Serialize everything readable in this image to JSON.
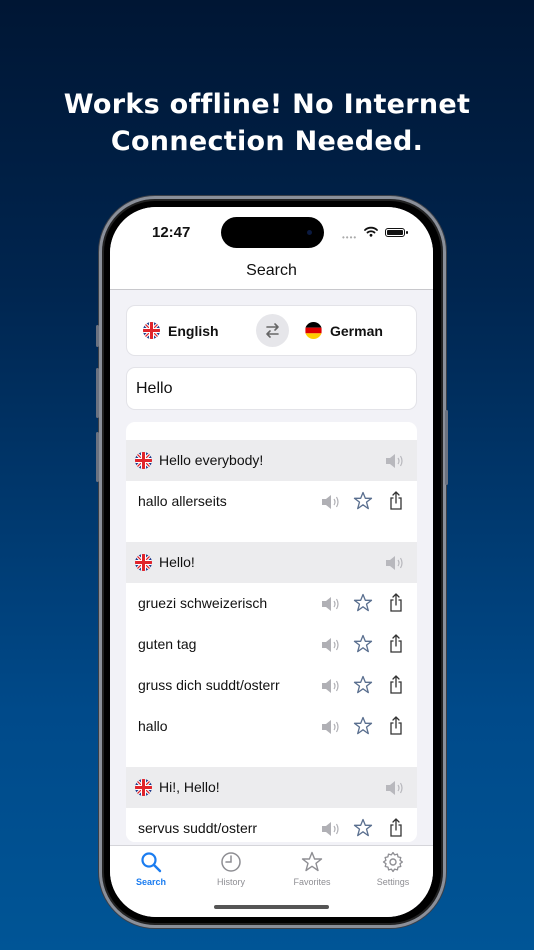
{
  "promo": {
    "headline_line1": "Works offline! No Internet",
    "headline_line2": "Connection Needed."
  },
  "status_bar": {
    "time": "12:47",
    "icons": [
      "cellular-dots-icon",
      "wifi-icon",
      "battery-icon"
    ]
  },
  "nav": {
    "title": "Search"
  },
  "language_selector": {
    "source": {
      "label": "English",
      "flag": "uk-flag-icon"
    },
    "target": {
      "label": "German",
      "flag": "germany-flag-icon"
    },
    "swap_icon": "swap-arrows-icon"
  },
  "search": {
    "value": "Hello",
    "placeholder": ""
  },
  "results": [
    {
      "source_phrase": "Hello everybody!",
      "translations": [
        "hallo allerseits"
      ]
    },
    {
      "source_phrase": "Hello!",
      "translations": [
        "gruezi schweizerisch",
        "guten tag",
        "gruss dich suddt/osterr",
        "hallo"
      ]
    },
    {
      "source_phrase": "Hi!, Hello!",
      "translations": [
        "servus suddt/osterr"
      ]
    }
  ],
  "tabbar": {
    "items": [
      {
        "label": "Search",
        "icon": "magnifier-icon",
        "active": true
      },
      {
        "label": "History",
        "icon": "clock-icon",
        "active": false
      },
      {
        "label": "Favorites",
        "icon": "star-icon",
        "active": false
      },
      {
        "label": "Settings",
        "icon": "gear-icon",
        "active": false
      }
    ]
  },
  "colors": {
    "accent": "#1a7cf0",
    "background_top": "#001634",
    "background_bottom": "#005596",
    "group_header": "#ececee",
    "icon_gray": "#b0b0b5",
    "star_outline": "#5a6f8f"
  }
}
